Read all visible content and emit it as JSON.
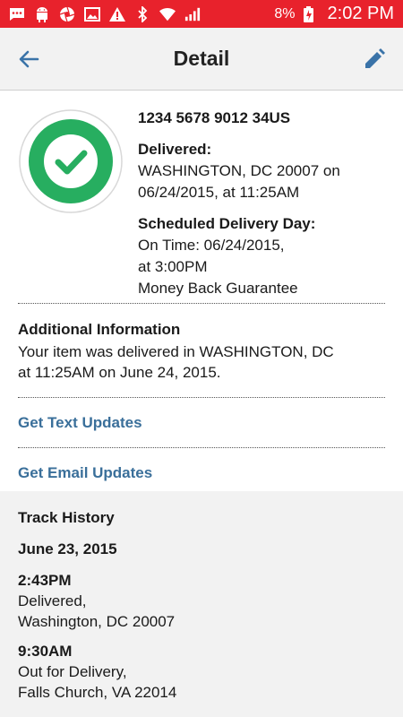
{
  "status_bar": {
    "battery_percent": "8%",
    "time": "2:02 PM",
    "icons": [
      "messages-icon",
      "android-icon",
      "camera-aperture-icon",
      "gallery-icon",
      "warning-icon",
      "bluetooth-icon",
      "wifi-icon",
      "signal-icon",
      "battery-charging-icon"
    ]
  },
  "app_bar": {
    "title": "Detail",
    "back_icon": "arrow-back-icon",
    "edit_icon": "pencil-icon"
  },
  "summary": {
    "tracking_number": "1234 5678 9012 34US",
    "status_icon": "check-circle-icon",
    "status_color": "#27ae60",
    "delivered_label": "Delivered:",
    "delivered_line1": "WASHINGTON, DC 20007 on",
    "delivered_line2": "06/24/2015, at 11:25AM",
    "scheduled_label": "Scheduled Delivery Day:",
    "scheduled_line1": "On Time: 06/24/2015,",
    "scheduled_line2": "at 3:00PM",
    "scheduled_line3": "Money Back Guarantee"
  },
  "additional": {
    "title": "Additional Information",
    "line1": "Your item was delivered in WASHINGTON, DC",
    "line2": "at 11:25AM on June 24, 2015."
  },
  "links": {
    "text_updates": "Get Text Updates",
    "email_updates": "Get Email Updates",
    "link_color": "#3a6f9a"
  },
  "history": {
    "title": "Track History",
    "date": "June 23, 2015",
    "events": [
      {
        "time": "2:43PM",
        "status": "Delivered,",
        "location": "Washington, DC 20007"
      },
      {
        "time": "9:30AM",
        "status": "Out for Delivery,",
        "location": "Falls Church, VA 22014"
      }
    ]
  },
  "theme": {
    "status_bar_color": "#e8222c",
    "app_bar_color": "#f2f2f2",
    "accent_blue": "#3a73a8"
  }
}
